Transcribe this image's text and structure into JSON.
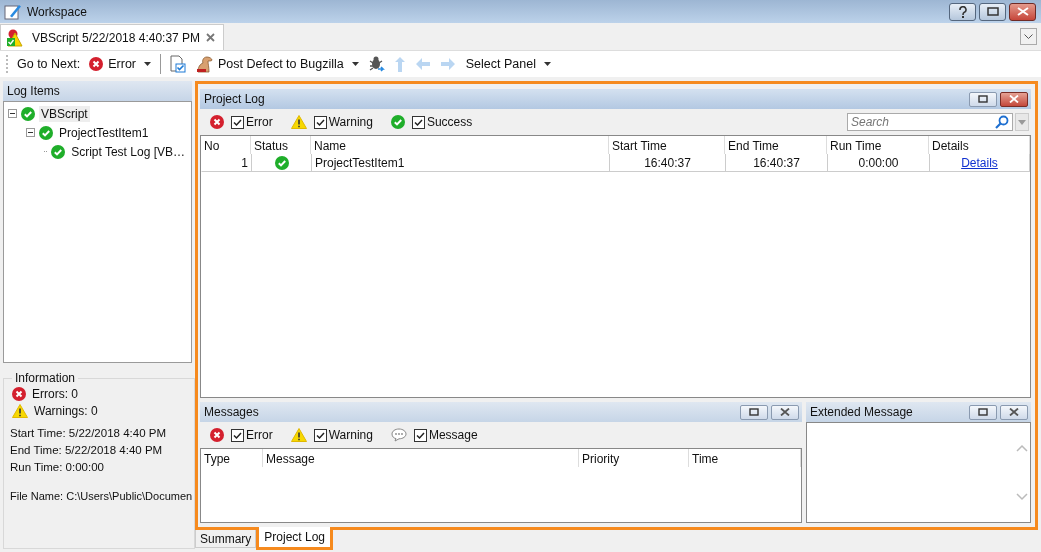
{
  "window": {
    "title": "Workspace"
  },
  "document_tab": {
    "label": "VBScript 5/22/2018 4:40:37 PM",
    "selected": true
  },
  "toolbar": [
    {
      "kind": "label",
      "label": "Go to Next:"
    },
    {
      "kind": "error_dropdown",
      "label": "Error"
    },
    {
      "kind": "report",
      "disabled": false
    },
    {
      "kind": "defect_dropdown",
      "label": "Post Defect to Bugzilla"
    },
    {
      "kind": "bug",
      "disabled": false
    },
    {
      "kind": "up",
      "disabled": true
    },
    {
      "kind": "back",
      "disabled": true
    },
    {
      "kind": "forward",
      "disabled": true
    },
    {
      "kind": "menu",
      "label": "Select Panel"
    }
  ],
  "log_items": {
    "title": "Log Items",
    "tree": [
      {
        "label": "VBScript",
        "expanded": true,
        "selected": true,
        "children": [
          {
            "label": "ProjectTestItem1",
            "expanded": true,
            "selected": false,
            "children": [
              {
                "label": "Script Test Log [VB…",
                "selected": false
              }
            ]
          }
        ]
      }
    ]
  },
  "information": {
    "title": "Information",
    "errors": "Errors: 0",
    "warnings": "Warnings: 0",
    "start_time": "Start Time: 5/22/2018 4:40 PM",
    "end_time": "End Time: 5/22/2018 4:40 PM",
    "run_time": "Run Time: 0:00:00",
    "file_name": "File Name: C:\\Users\\Public\\Documen"
  },
  "project_log": {
    "title": "Project Log",
    "filters": [
      {
        "kind": "error",
        "label": "Error",
        "checked": true
      },
      {
        "kind": "warning",
        "label": "Warning",
        "checked": true
      },
      {
        "kind": "success",
        "label": "Success",
        "checked": true
      }
    ],
    "search": {
      "placeholder": "Search"
    },
    "columns": [
      "No",
      "Status",
      "Name",
      "Start Time",
      "End Time",
      "Run Time",
      "Details"
    ],
    "rows": [
      {
        "no": "1",
        "name": "ProjectTestItem1",
        "start_time": "16:40:37",
        "end_time": "16:40:37",
        "run_time": "0:00:00",
        "details": "Details"
      }
    ]
  },
  "messages": {
    "title": "Messages",
    "filters": [
      {
        "kind": "error",
        "label": "Error",
        "checked": true
      },
      {
        "kind": "warning",
        "label": "Warning",
        "checked": true
      },
      {
        "kind": "message",
        "label": "Message",
        "checked": true
      }
    ],
    "columns": [
      "Type",
      "Message",
      "Priority",
      "Time"
    ]
  },
  "extended_message": {
    "title": "Extended Message"
  },
  "bottom_tabs": [
    {
      "label": "Summary",
      "selected": false
    },
    {
      "label": "Project Log",
      "selected": true
    }
  ]
}
